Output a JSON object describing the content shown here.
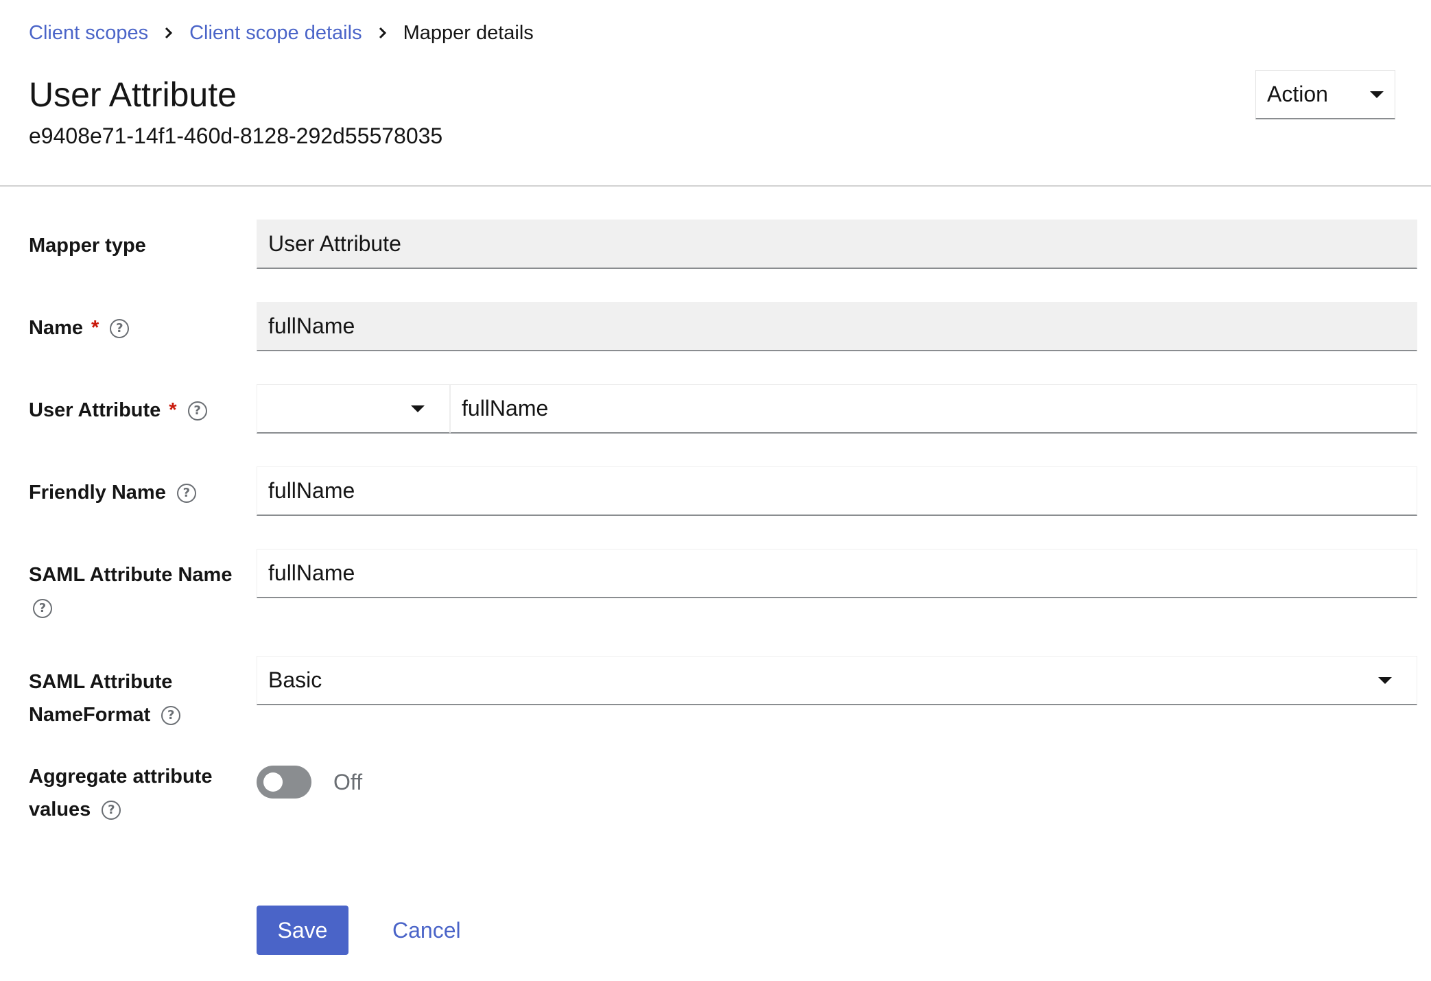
{
  "breadcrumb": {
    "items": [
      "Client scopes",
      "Client scope details"
    ],
    "current": "Mapper details"
  },
  "header": {
    "title": "User Attribute",
    "subtitle": "e9408e71-14f1-460d-8128-292d55578035",
    "action_label": "Action"
  },
  "form": {
    "mapper_type": {
      "label": "Mapper type",
      "value": "User Attribute"
    },
    "name": {
      "label": "Name",
      "required": "*",
      "value": "fullName"
    },
    "user_attribute": {
      "label": "User Attribute",
      "required": "*",
      "select_value": "",
      "value": "fullName"
    },
    "friendly_name": {
      "label": "Friendly Name",
      "value": "fullName"
    },
    "saml_attribute_name": {
      "label": "SAML Attribute Name",
      "value": "fullName"
    },
    "saml_attribute_nameformat": {
      "label_line1": "SAML Attribute",
      "label_line2": "NameFormat",
      "value": "Basic"
    },
    "aggregate_attribute_values": {
      "label_line1": "Aggregate attribute",
      "label_line2": "values",
      "state": "Off"
    }
  },
  "buttons": {
    "save": "Save",
    "cancel": "Cancel"
  },
  "icons": {
    "help": "help-circle-icon",
    "caret": "caret-down-icon",
    "chevron": "chevron-right-icon"
  },
  "colors": {
    "link": "#4a64c8",
    "primary": "#4a64c8",
    "required": "#c9190b",
    "readonly_bg": "#f0f0f0",
    "switch_off": "#8a8d90"
  }
}
